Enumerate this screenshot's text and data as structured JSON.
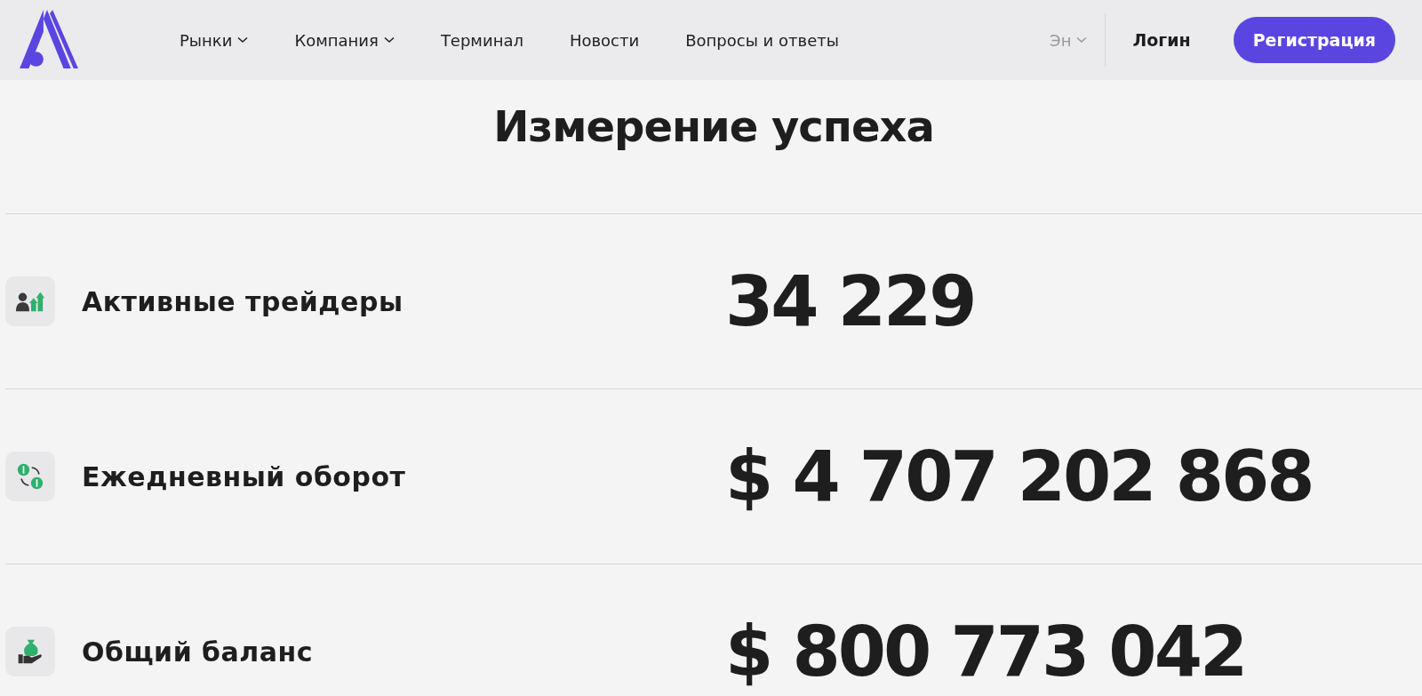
{
  "nav": [
    {
      "label": "Рынки",
      "dropdown": true
    },
    {
      "label": "Компания",
      "dropdown": true
    },
    {
      "label": "Терминал",
      "dropdown": false
    },
    {
      "label": "Новости",
      "dropdown": false
    },
    {
      "label": "Вопросы и ответы",
      "dropdown": false
    }
  ],
  "language": "Эн",
  "login": "Логин",
  "register": "Регистрация",
  "title": "Измерение успеха",
  "stats": [
    {
      "kind": "traders",
      "label": "Активные трейдеры",
      "value": "34 229"
    },
    {
      "kind": "turnover",
      "label": "Ежедневный оборот",
      "value": "$ 4 707 202 868"
    },
    {
      "kind": "balance",
      "label": "Общий баланс",
      "value": "$ 800 773 042"
    }
  ]
}
